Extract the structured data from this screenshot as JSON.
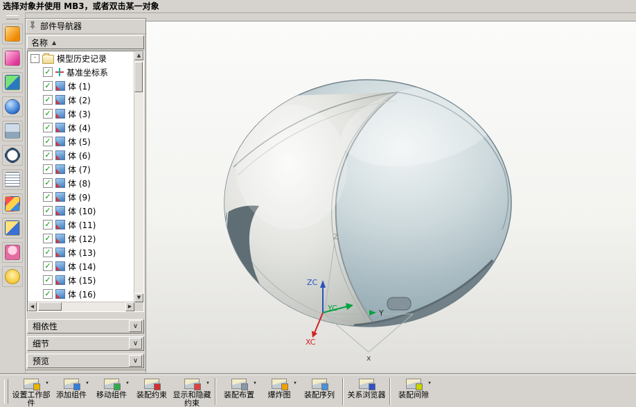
{
  "status_bar": {
    "text": "选择对象并使用 MB3，或者双击某一对象"
  },
  "left_toolbar": {
    "icons": [
      "sketch-icon",
      "datum-plane-icon",
      "solid-body-icon",
      "info-sphere-icon",
      "material-box-icon",
      "clock-icon",
      "list-view-icon",
      "color-palette-icon",
      "measure-icon",
      "user-group-icon",
      "bulb-icon"
    ]
  },
  "navigator": {
    "title": "部件导航器",
    "column_header": "名称",
    "sort_indicator": "▲",
    "tree": {
      "root": {
        "label": "模型历史记录",
        "expanded": true
      },
      "items": [
        {
          "label": "基准坐标系",
          "icon": "csys-icon",
          "checked": true
        },
        {
          "label": "体 (1)",
          "icon": "body-icon",
          "checked": true
        },
        {
          "label": "体 (2)",
          "icon": "body-icon",
          "checked": true
        },
        {
          "label": "体 (3)",
          "icon": "body-icon",
          "checked": true
        },
        {
          "label": "体 (4)",
          "icon": "body-icon",
          "checked": true
        },
        {
          "label": "体 (5)",
          "icon": "body-icon",
          "checked": true
        },
        {
          "label": "体 (6)",
          "icon": "body-icon",
          "checked": true
        },
        {
          "label": "体 (7)",
          "icon": "body-icon",
          "checked": true
        },
        {
          "label": "体 (8)",
          "icon": "body-icon",
          "checked": true
        },
        {
          "label": "体 (9)",
          "icon": "body-icon",
          "checked": true
        },
        {
          "label": "体 (10)",
          "icon": "body-icon",
          "checked": true
        },
        {
          "label": "体 (11)",
          "icon": "body-icon",
          "checked": true
        },
        {
          "label": "体 (12)",
          "icon": "body-icon",
          "checked": true
        },
        {
          "label": "体 (13)",
          "icon": "body-icon",
          "checked": true
        },
        {
          "label": "体 (14)",
          "icon": "body-icon",
          "checked": true
        },
        {
          "label": "体 (15)",
          "icon": "body-icon",
          "checked": true
        },
        {
          "label": "体 (16)",
          "icon": "body-icon",
          "checked": true
        }
      ]
    },
    "sections": [
      {
        "label": "相依性"
      },
      {
        "label": "细节"
      },
      {
        "label": "预览"
      }
    ]
  },
  "viewport": {
    "triad": {
      "zc": "ZC",
      "yc": "YC",
      "xc": "XC",
      "z": "Z",
      "y": "Y",
      "x": "x"
    }
  },
  "bottom_toolbar": {
    "groups": [
      {
        "items": [
          {
            "label": "设置工作部件",
            "dropdown": true
          },
          {
            "label": "添加组件",
            "dropdown": true
          },
          {
            "label": "移动组件",
            "dropdown": true
          },
          {
            "label": "装配约束",
            "dropdown": false
          },
          {
            "label": "显示和隐藏约束",
            "dropdown": true
          }
        ]
      },
      {
        "items": [
          {
            "label": "装配布置",
            "dropdown": true
          },
          {
            "label": "爆炸图",
            "dropdown": true
          },
          {
            "label": "装配序列",
            "dropdown": false
          }
        ]
      },
      {
        "items": [
          {
            "label": "关系浏览器",
            "dropdown": false
          }
        ]
      },
      {
        "items": [
          {
            "label": "装配间隙",
            "dropdown": true
          }
        ]
      }
    ]
  }
}
